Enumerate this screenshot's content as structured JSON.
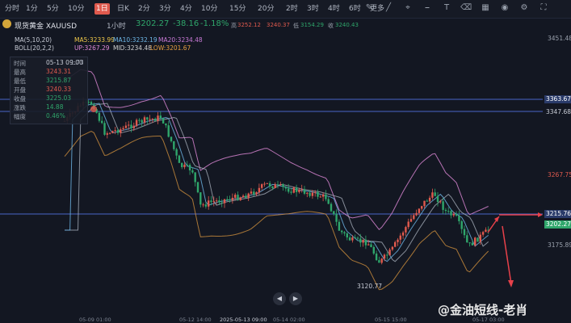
{
  "toolbar": {
    "timeframes": [
      "分时",
      "1分",
      "5分",
      "10分",
      "1日",
      "日K",
      "2分",
      "3分",
      "4分",
      "10分",
      "15分",
      "20分",
      "2时",
      "3时",
      "4时",
      "6时",
      "更多"
    ],
    "active_timeframe": "1日"
  },
  "header": {
    "symbol": "现货黄金 XAUUSD",
    "interval": "1小时",
    "price": "3202.27",
    "change": "-38.16",
    "change_pct": "-1.18%",
    "high_label": "高",
    "high": "3252.12",
    "open_val": "3240.37",
    "low_label": "低",
    "low": "3154.29",
    "close_label": "收",
    "close_val": "3240.43"
  },
  "indicators": {
    "ma_label": "MA(5,10,20)",
    "ma5": "MA5:3233.99",
    "ma10": "MA10:3232.19",
    "ma20": "MA20:3234.48",
    "boll_label": "BOLL(20,2,2)",
    "up": "UP:3267.29",
    "mid": "MID:3234.48",
    "low": "LOW:3201.67"
  },
  "info_panel": {
    "rows": [
      {
        "k": "时间",
        "v": "05-13 09:00"
      },
      {
        "k": "最高",
        "v": "3243.31"
      },
      {
        "k": "最低",
        "v": "3215.87"
      },
      {
        "k": "开盘",
        "v": "3240.33"
      },
      {
        "k": "收盘",
        "v": "3225.03"
      },
      {
        "k": "涨跌",
        "v": "14.88"
      },
      {
        "k": "幅度",
        "v": "0.46%"
      }
    ],
    "side_val": "1.73"
  },
  "price_axis": {
    "top": "3451.48",
    "line1": "3363.67",
    "line2": "3347.68",
    "mid": "3267.75",
    "line3": "3215.76",
    "current": "3202.27",
    "low": "3175.89",
    "marker_low": "3120.77"
  },
  "x_labels": [
    "05-09 01:00",
    "05-12 14:00",
    "2025-05-13 09:00",
    "05-14 02:00",
    "05-15 15:00",
    "05-17 03:00"
  ],
  "watermark": "@金油短线-老肖",
  "colors": {
    "up": "#e05a4e",
    "down": "#2fa66b",
    "accent": "#e05a4e"
  }
}
